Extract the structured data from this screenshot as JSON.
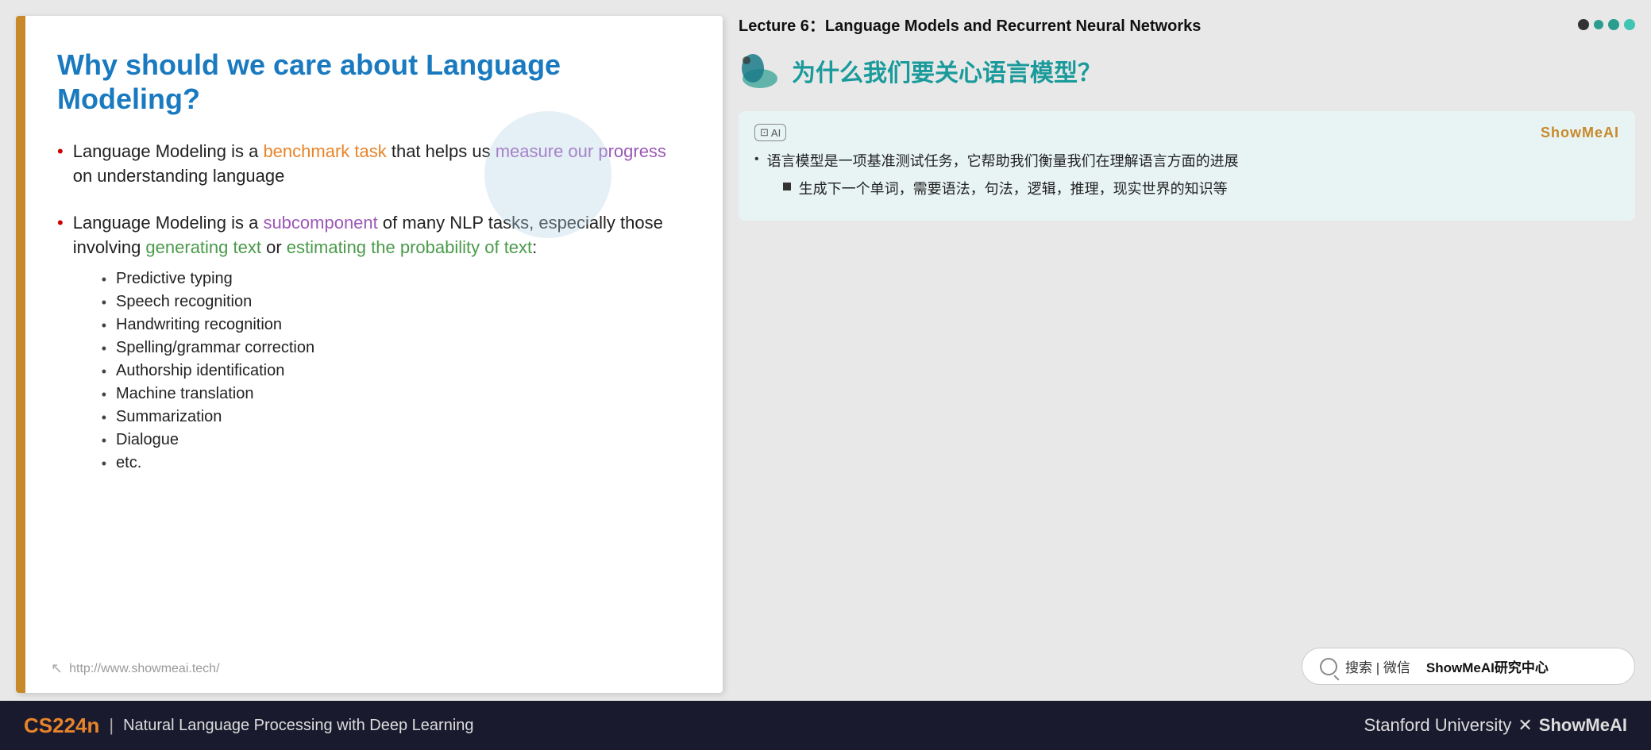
{
  "slide_left": {
    "title": "Why should we care about Language Modeling?",
    "bullet1": {
      "text_before": "Language Modeling is a ",
      "highlight1": "benchmark task",
      "text_middle": " that helps us ",
      "highlight2": "measure our progress",
      "text_after": " on understanding language"
    },
    "bullet2": {
      "text_before": "Language Modeling is a ",
      "highlight1": "subcomponent",
      "text_middle": " of many NLP tasks, especially those involving ",
      "highlight2": "generating text",
      "text_middle2": " or ",
      "highlight3": "estimating the probability of text",
      "text_after": ":"
    },
    "sub_bullets": [
      "Predictive typing",
      "Speech recognition",
      "Handwriting recognition",
      "Spelling/grammar correction",
      "Authorship identification",
      "Machine translation",
      "Summarization",
      "Dialogue",
      "etc."
    ],
    "footer_url": "http://www.showmeai.tech/"
  },
  "slide_right": {
    "lecture_title": "Lecture 6：Language Models and Recurrent Neural Networks",
    "zh_title": "为什么我们要关心语言模型？",
    "translation_box": {
      "ai_label": "AI",
      "showmeai_label": "ShowMeAI",
      "bullet1": "语言模型是一项基准测试任务，它帮助我们衡量我们在理解语言方面的进展",
      "sub_bullet1": "生成下一个单词，需要语法，句法，逻辑，推理，现实世界的知识等"
    },
    "search_placeholder": "搜索 | 微信",
    "search_bold": "ShowMeAI研究中心"
  },
  "bottom_bar": {
    "cs224n": "CS224n",
    "divider": "|",
    "subtitle": "Natural Language Processing with Deep Learning",
    "right_text": "Stanford University",
    "x_sign": "✕",
    "showmeai": "ShowMeAI"
  }
}
